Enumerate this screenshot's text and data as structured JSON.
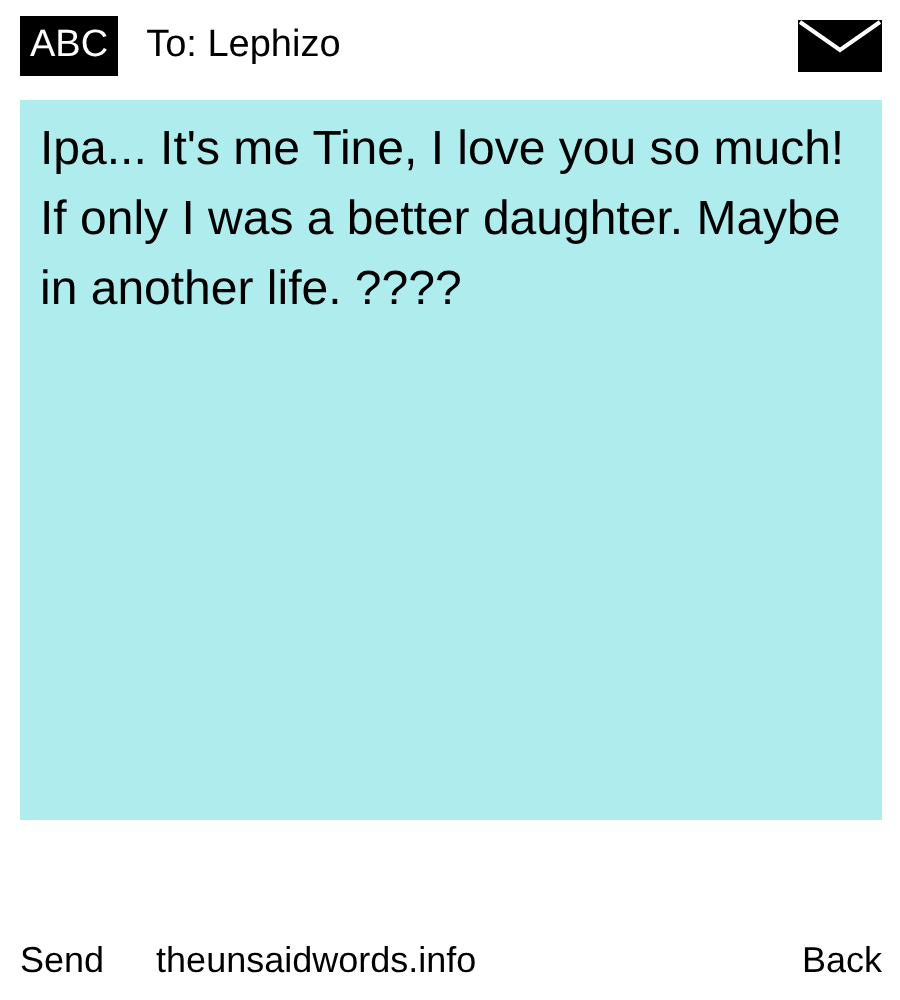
{
  "header": {
    "mode": "ABC",
    "recipient": "To: Lephizo"
  },
  "message": "Ipa... It's me Tine, I love you so much! If only I was a better daughter. Maybe in another life. ????",
  "footer": {
    "left": "Send",
    "center": "theunsaidwords.info",
    "right": "Back"
  }
}
